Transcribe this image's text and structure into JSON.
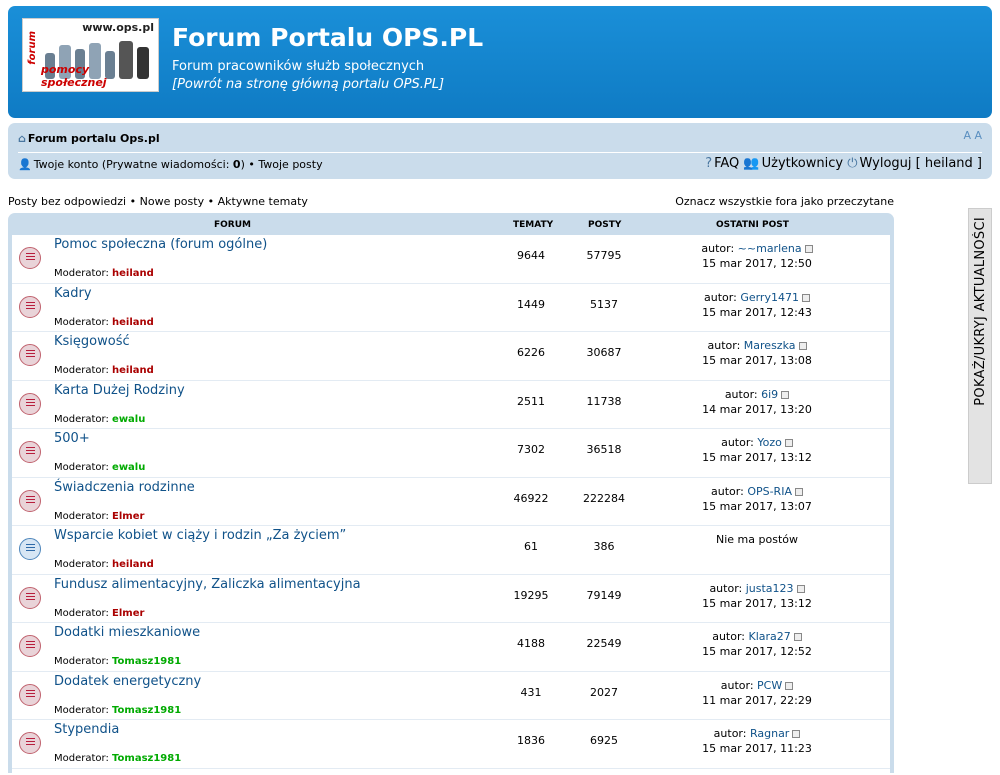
{
  "header": {
    "logo_url_text": "www.ops.pl",
    "logo_forum_text": "forum",
    "logo_bottom_text": "pomocy społecznej",
    "title": "Forum Portalu OPS.PL",
    "subtitle": "Forum pracowników służb społecznych",
    "back_link": "[Powrót na stronę główną portalu OPS.PL]"
  },
  "navbar": {
    "home_label": "Forum portalu Ops.pl",
    "font_size_label": "A A",
    "account_label": "Twoje konto",
    "pm_prefix": "(Prywatne wiadomości: ",
    "pm_count": "0",
    "pm_suffix": ")",
    "separator": "•",
    "your_posts": "Twoje posty",
    "faq": "FAQ",
    "users": "Użytkownicy",
    "logout": "Wyloguj",
    "username": "[ heiland ]"
  },
  "actions": {
    "unanswered": "Posty bez odpowiedzi",
    "new_posts": "Nowe posty",
    "active": "Aktywne tematy",
    "mark_read": "Oznacz wszystkie fora jako przeczytane"
  },
  "table": {
    "headers": {
      "forum": "Forum",
      "topics": "Tematy",
      "posts": "Posty",
      "last_post": "Ostatni post"
    },
    "moderator_label": "Moderator:",
    "author_label": "autor:",
    "rows": [
      {
        "name": "Pomoc społeczna (forum ogólne)",
        "moderator": "heiland",
        "mod_color": "#aa0000",
        "topics": "9644",
        "posts": "57795",
        "author": "~~marlena",
        "date": "15 mar 2017, 12:50",
        "status": "unread"
      },
      {
        "name": "Kadry",
        "moderator": "heiland",
        "mod_color": "#aa0000",
        "topics": "1449",
        "posts": "5137",
        "author": "Gerry1471",
        "date": "15 mar 2017, 12:43",
        "status": "unread"
      },
      {
        "name": "Księgowość",
        "moderator": "heiland",
        "mod_color": "#aa0000",
        "topics": "6226",
        "posts": "30687",
        "author": "Mareszka",
        "date": "15 mar 2017, 13:08",
        "status": "unread"
      },
      {
        "name": "Karta Dużej Rodziny",
        "moderator": "ewalu",
        "mod_color": "#00aa00",
        "topics": "2511",
        "posts": "11738",
        "author": "6i9",
        "date": "14 mar 2017, 13:20",
        "status": "unread"
      },
      {
        "name": "500+",
        "moderator": "ewalu",
        "mod_color": "#00aa00",
        "topics": "7302",
        "posts": "36518",
        "author": "Yozo",
        "date": "15 mar 2017, 13:12",
        "status": "unread"
      },
      {
        "name": "Świadczenia rodzinne",
        "moderator": "Elmer",
        "mod_color": "#aa0000",
        "topics": "46922",
        "posts": "222284",
        "author": "OPS-RIA",
        "date": "15 mar 2017, 13:07",
        "status": "unread"
      },
      {
        "name": "Wsparcie kobiet w ciąży i rodzin „Za życiem”",
        "moderator": "heiland",
        "mod_color": "#aa0000",
        "topics": "61",
        "posts": "386",
        "author": "",
        "date": "",
        "no_posts": "Nie ma postów",
        "status": "read"
      },
      {
        "name": "Fundusz alimentacyjny, Zaliczka alimentacyjna",
        "moderator": "Elmer",
        "mod_color": "#aa0000",
        "topics": "19295",
        "posts": "79149",
        "author": "justa123",
        "date": "15 mar 2017, 13:12",
        "status": "unread"
      },
      {
        "name": "Dodatki mieszkaniowe",
        "moderator": "Tomasz1981",
        "mod_color": "#00aa00",
        "topics": "4188",
        "posts": "22549",
        "author": "Klara27",
        "date": "15 mar 2017, 12:52",
        "status": "unread"
      },
      {
        "name": "Dodatek energetyczny",
        "moderator": "Tomasz1981",
        "mod_color": "#00aa00",
        "topics": "431",
        "posts": "2027",
        "author": "PCW",
        "date": "11 mar 2017, 22:29",
        "status": "unread"
      },
      {
        "name": "Stypendia",
        "moderator": "Tomasz1981",
        "mod_color": "#00aa00",
        "topics": "1836",
        "posts": "6925",
        "author": "Ragnar",
        "date": "15 mar 2017, 11:23",
        "status": "unread"
      }
    ]
  },
  "side_panel": {
    "label": "POKAŻ/UKRYJ AKTUALNOŚCI"
  }
}
